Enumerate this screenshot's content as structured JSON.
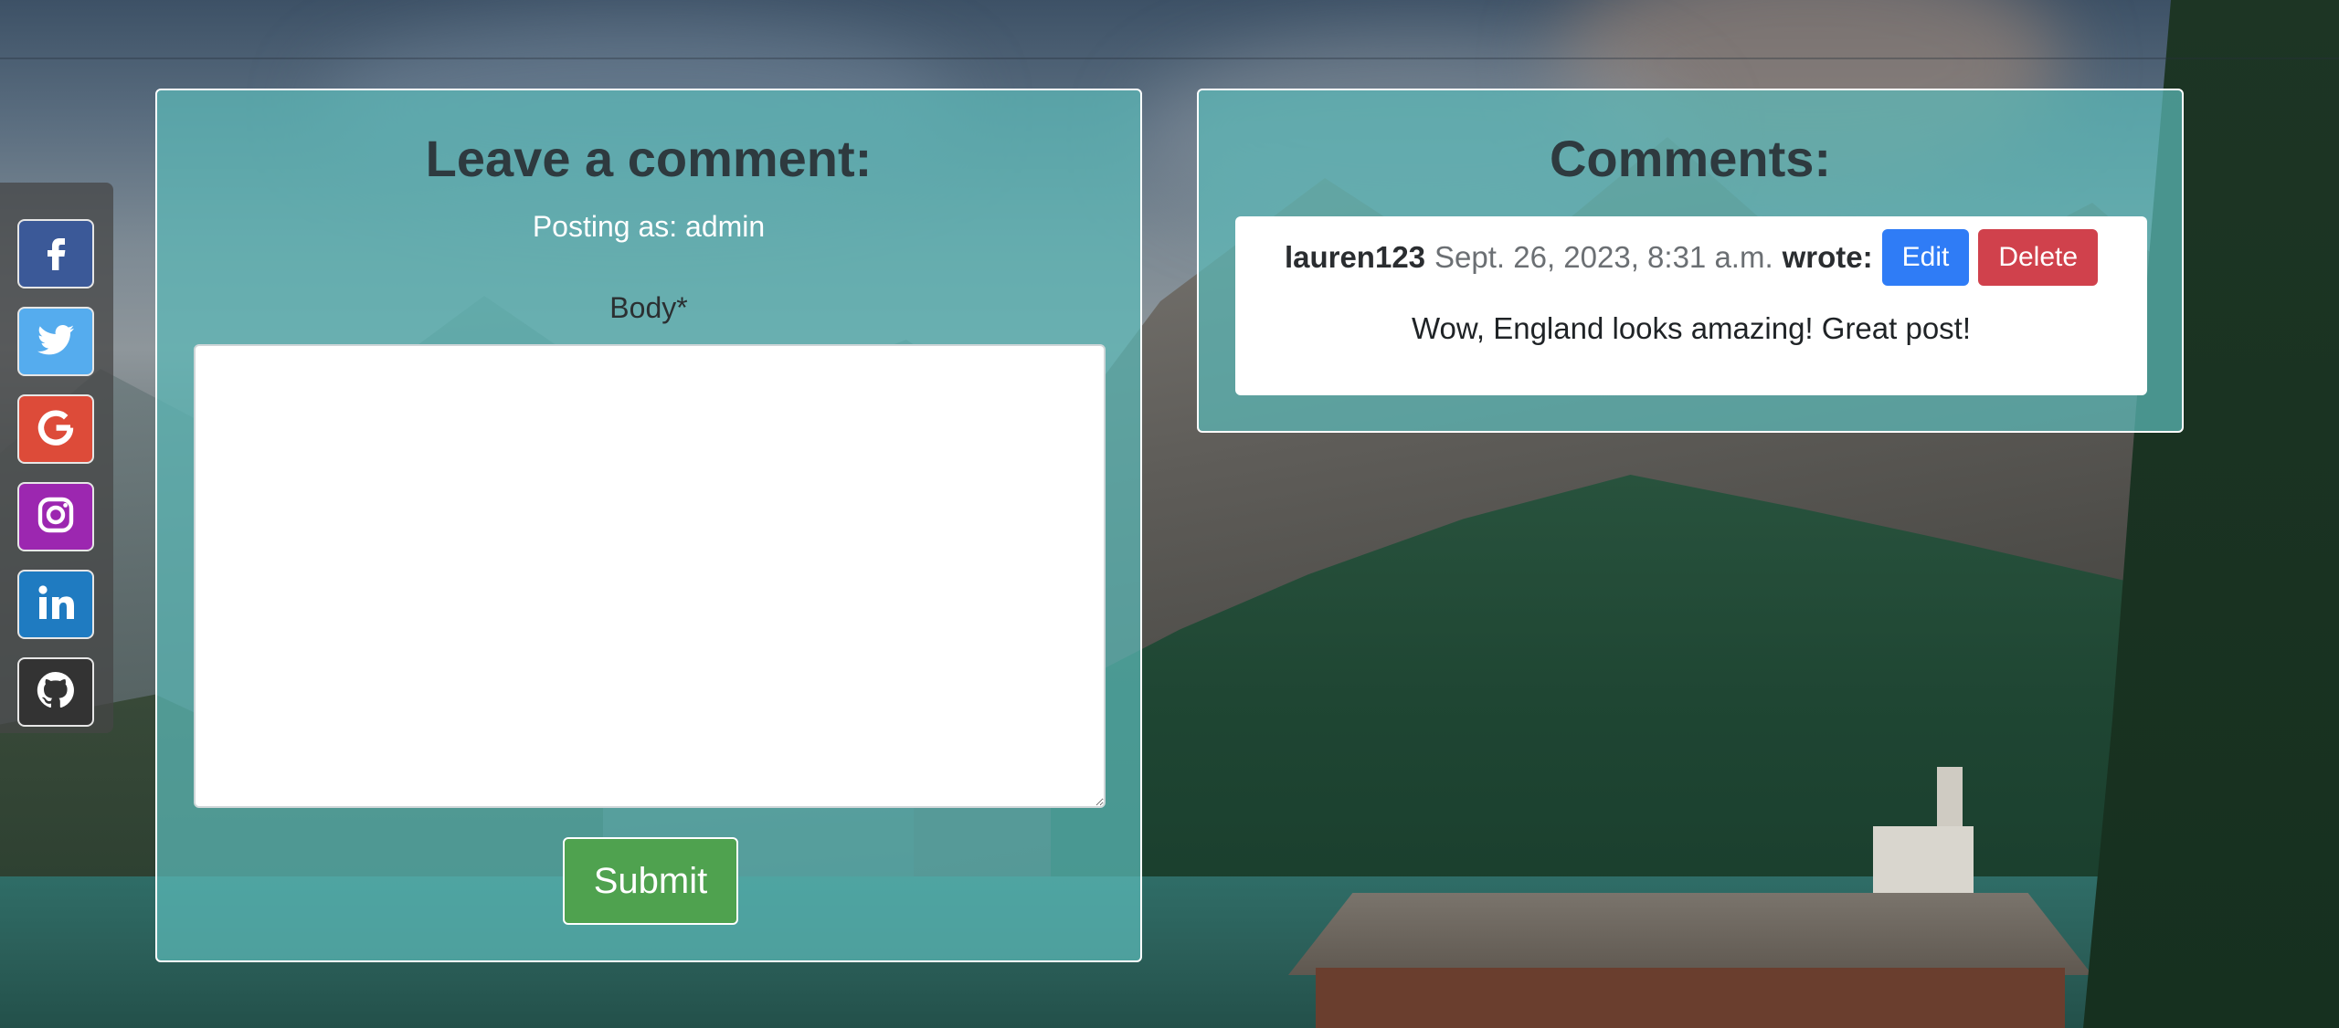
{
  "comment_form": {
    "title": "Leave a comment:",
    "posting_label": "Posting as:",
    "posting_user": "admin",
    "body_label": "Body*",
    "body_value": "",
    "submit_label": "Submit"
  },
  "comments": {
    "title": "Comments:",
    "items": [
      {
        "author": "lauren123",
        "date": "Sept. 26, 2023, 8:31 a.m.",
        "wrote_label": "wrote:",
        "edit_label": "Edit",
        "delete_label": "Delete",
        "body": "Wow, England looks amazing! Great post!"
      }
    ]
  },
  "social_links": [
    {
      "icon": "facebook-icon",
      "color": "#3b5998"
    },
    {
      "icon": "twitter-icon",
      "color": "#55acee"
    },
    {
      "icon": "google-icon",
      "color": "#dd4b39"
    },
    {
      "icon": "instagram-icon",
      "color": "#9c27b0"
    },
    {
      "icon": "linkedin-icon",
      "color": "#1f7bc1"
    },
    {
      "icon": "github-icon",
      "color": "#333333"
    }
  ]
}
